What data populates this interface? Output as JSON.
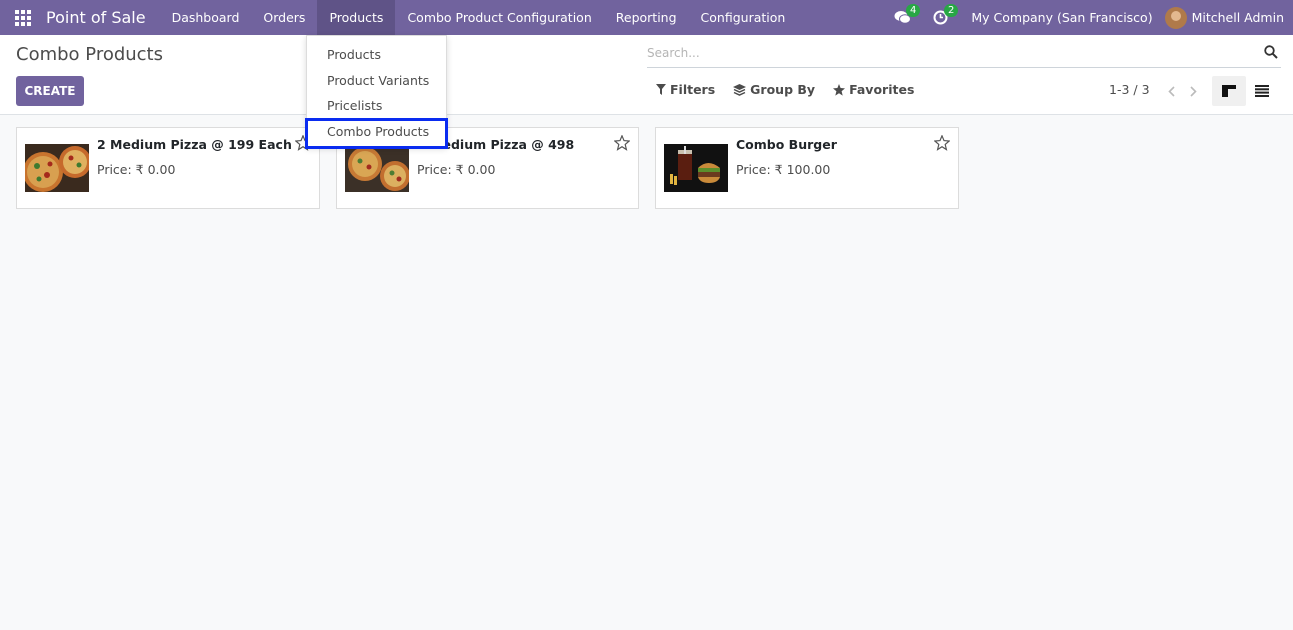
{
  "navbar": {
    "app_name": "Point of Sale",
    "menu": [
      "Dashboard",
      "Orders",
      "Products",
      "Combo Product Configuration",
      "Reporting",
      "Configuration"
    ],
    "messages_count": "4",
    "activities_count": "2",
    "company": "My Company (San Francisco)",
    "user": "Mitchell Admin"
  },
  "control_panel": {
    "title": "Combo Products",
    "create_label": "CREATE",
    "search_placeholder": "Search...",
    "filters_label": "Filters",
    "group_by_label": "Group By",
    "favorites_label": "Favorites",
    "pager": "1-3 / 3"
  },
  "products_dropdown": {
    "items": [
      "Products",
      "Product Variants",
      "Pricelists",
      "Combo Products"
    ],
    "highlighted": "Combo Products"
  },
  "cards": [
    {
      "title": "2 Medium Pizza @ 199 Each",
      "price": "Price: ₹ 0.00"
    },
    {
      "title": "2 Medium Pizza @ 498",
      "price": "Price: ₹ 0.00"
    },
    {
      "title": "Combo Burger",
      "price": "Price: ₹ 100.00"
    }
  ],
  "colors": {
    "brand": "#71639e",
    "badge": "#28a745",
    "highlight_box": "#0a2cf0"
  }
}
